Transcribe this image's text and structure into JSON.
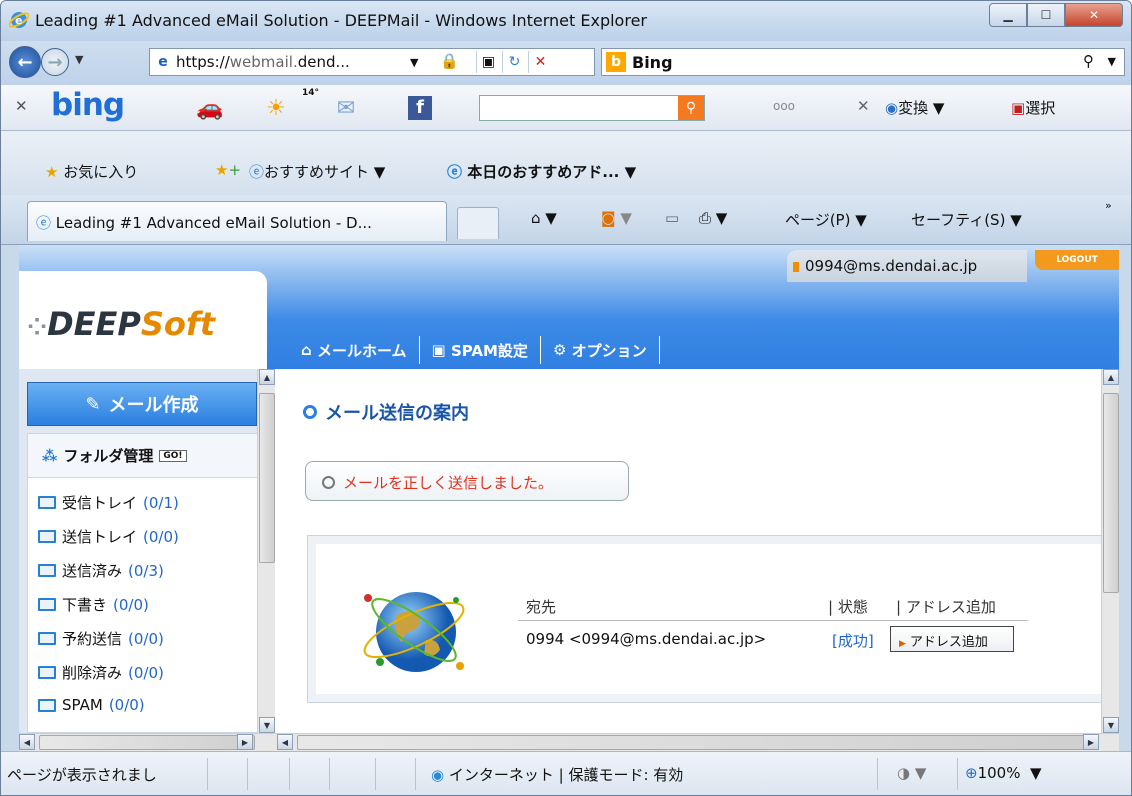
{
  "window": {
    "title": "Leading #1 Advanced eMail Solution - DEEPMail - Windows Internet Explorer"
  },
  "address_bar": {
    "url_prefix": "https://",
    "url_host_faded": "webmail.",
    "url_rest": "dend...",
    "search_label": "Bing"
  },
  "bing_toolbar": {
    "logo": "bing",
    "temperature": "14°",
    "dots": "ooo",
    "convert_label": "変換",
    "select_label": "選択"
  },
  "favorites_bar": {
    "favorites_label": "お気に入り",
    "suggested_sites_label": "おすすめサイト",
    "addons_label": "本日のおすすめアド..."
  },
  "tab_bar": {
    "active_tab": "Leading #1 Advanced eMail Solution - D...",
    "page_menu": "ページ(P)",
    "safety_menu": "セーフティ(S)"
  },
  "app": {
    "logo_prefix": "DEEP",
    "logo_suffix": "Soft",
    "user_email": "0994@ms.dendai.ac.jp",
    "logout_label": "LOGOUT",
    "nav": [
      "メールホーム",
      "SPAM設定",
      "オプション"
    ],
    "compose_label": "メール作成",
    "folder_manager_label": "フォルダ管理",
    "go_label": "GO!",
    "folders": [
      {
        "name": "受信トレイ",
        "count": "(0/1)"
      },
      {
        "name": "送信トレイ",
        "count": "(0/0)"
      },
      {
        "name": "送信済み",
        "count": "(0/3)"
      },
      {
        "name": "下書き",
        "count": "(0/0)"
      },
      {
        "name": "予約送信",
        "count": "(0/0)"
      },
      {
        "name": "削除済み",
        "count": "(0/0)"
      },
      {
        "name": "SPAM",
        "count": "(0/0)"
      }
    ],
    "page_title": "メール送信の案内",
    "success_message": "メールを正しく送信しました。",
    "table": {
      "headers": [
        "宛先",
        "| 状態",
        "| アドレス追加"
      ],
      "recipient": "0994 <0994@ms.dendai.ac.jp>",
      "status": "[成功]",
      "add_address_button": "アドレス追加"
    }
  },
  "status_bar": {
    "status_text": "ページが表示されまし",
    "zone_text": "インターネット | 保護モード: 有効",
    "zoom": "100%"
  }
}
